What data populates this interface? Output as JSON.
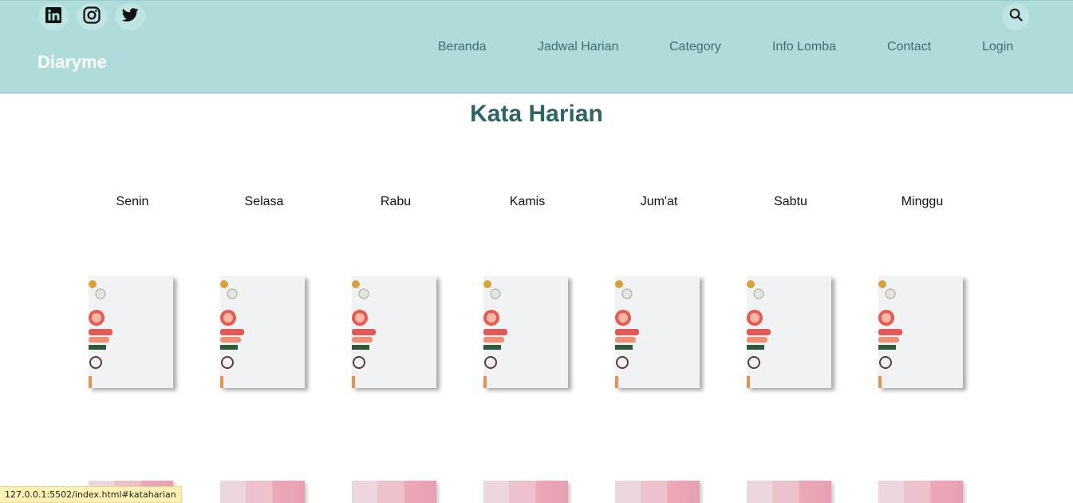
{
  "header": {
    "brand": "Diaryme",
    "social": [
      {
        "icon": "linkedin-icon"
      },
      {
        "icon": "instagram-icon"
      },
      {
        "icon": "twitter-icon"
      }
    ],
    "search_icon": "search-icon",
    "nav": [
      "Beranda",
      "Jadwal Harian",
      "Category",
      "Info Lomba",
      "Contact",
      "Login"
    ]
  },
  "main": {
    "title": "Kata Harian",
    "days": [
      "Senin",
      "Selasa",
      "Rabu",
      "Kamis",
      "Jum'at",
      "Sabtu",
      "Minggu"
    ]
  },
  "status_bar": {
    "url": "127.0.0.1:5502/index.html#kataharian"
  },
  "colors": {
    "header_bg": "#b0dbdb",
    "title": "#2f6464",
    "nav_text": "#3d6f72"
  }
}
